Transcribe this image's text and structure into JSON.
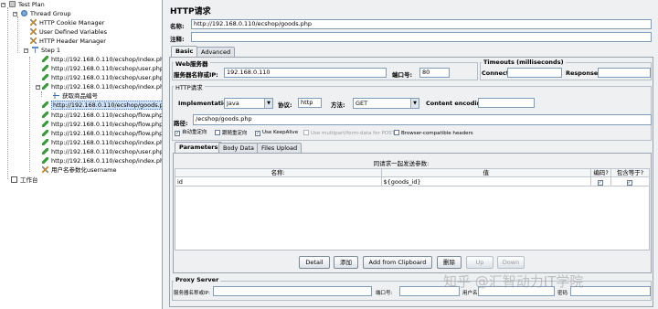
{
  "tree": {
    "items": [
      {
        "label": "Test Plan",
        "icon": "test-plan-icon"
      },
      {
        "label": "Thread Group",
        "icon": "thread-group-icon"
      },
      {
        "label": "HTTP Cookie Manager",
        "icon": "wrench-icon"
      },
      {
        "label": "User Defined Variables",
        "icon": "wrench-icon"
      },
      {
        "label": "HTTP Header Manager",
        "icon": "wrench-icon"
      },
      {
        "label": "Step 1",
        "icon": "step-icon"
      },
      {
        "label": "http://192.168.0.110/ecshop/index.php",
        "icon": "sampler-icon"
      },
      {
        "label": "http://192.168.0.110/ecshop/user.php",
        "icon": "sampler-icon"
      },
      {
        "label": "http://192.168.0.110/ecshop/user.php",
        "icon": "sampler-icon"
      },
      {
        "label": "http://192.168.0.110/ecshop/index.php",
        "icon": "sampler-icon"
      },
      {
        "label": "获取商品编号",
        "icon": "extractor-icon"
      },
      {
        "label": "http://192.168.0.110/ecshop/goods.php",
        "icon": "sampler-icon"
      },
      {
        "label": "http://192.168.0.110/ecshop/flow.php",
        "icon": "sampler-icon"
      },
      {
        "label": "http://192.168.0.110/ecshop/flow.php",
        "icon": "sampler-icon"
      },
      {
        "label": "http://192.168.0.110/ecshop/flow.php",
        "icon": "sampler-icon"
      },
      {
        "label": "http://192.168.0.110/ecshop/index.php",
        "icon": "sampler-icon"
      },
      {
        "label": "http://192.168.0.110/ecshop/user.php",
        "icon": "sampler-icon"
      },
      {
        "label": "http://192.168.0.110/ecshop/index.php",
        "icon": "sampler-icon"
      },
      {
        "label": "用户名参数化username",
        "icon": "wrench-icon"
      },
      {
        "label": "工作台",
        "icon": "workbench-icon"
      }
    ]
  },
  "panel": {
    "title": "HTTP请求",
    "name_label": "名称:",
    "name_value": "http://192.168.0.110/ecshop/goods.php",
    "comment_label": "注释:",
    "comment_value": "",
    "tabs": [
      "Basic",
      "Advanced"
    ]
  },
  "web_server": {
    "group_title": "Web服务器",
    "server_label": "服务器名称或IP:",
    "server_value": "192.168.0.110",
    "port_label": "端口号:",
    "port_value": "80"
  },
  "timeouts": {
    "group_title": "Timeouts (milliseconds)",
    "connect_label": "Connect:",
    "connect_value": "",
    "response_label": "Response:",
    "response_value": ""
  },
  "http_request": {
    "group_title": "HTTP请求",
    "impl_label": "Implementation:",
    "impl_value": "Java",
    "protocol_label": "协议:",
    "protocol_value": "http",
    "method_label": "方法:",
    "method_value": "GET",
    "encoding_label": "Content encoding:",
    "encoding_value": "",
    "path_label": "路径:",
    "path_value": "/ecshop/goods.php"
  },
  "options": [
    {
      "label": "自动重定向",
      "checked": true,
      "enabled": true
    },
    {
      "label": "跟随重定向",
      "checked": false,
      "enabled": true
    },
    {
      "label": "Use KeepAlive",
      "checked": true,
      "enabled": true
    },
    {
      "label": "Use multipart/form-data for POST",
      "checked": false,
      "enabled": false
    },
    {
      "label": "Browser-compatible headers",
      "checked": false,
      "enabled": true
    }
  ],
  "subtabs": [
    "Parameters",
    "Body Data",
    "Files Upload"
  ],
  "params": {
    "caption": "同请求一起发送参数:",
    "headers": [
      "名称:",
      "值",
      "编码?",
      "包含等于?"
    ],
    "rows": [
      {
        "name": "id",
        "value": "${goods_id}",
        "encode": true,
        "include_equals": true
      }
    ]
  },
  "buttons": [
    {
      "label": "Detail",
      "enabled": true
    },
    {
      "label": "添加",
      "enabled": true
    },
    {
      "label": "Add from Clipboard",
      "enabled": true
    },
    {
      "label": "删除",
      "enabled": true
    },
    {
      "label": "Up",
      "enabled": false
    },
    {
      "label": "Down",
      "enabled": false
    }
  ],
  "proxy": {
    "group_title": "Proxy Server",
    "server_label": "服务器名称或IP:",
    "port_label": "端口号:",
    "user_label": "用户名",
    "password_label": "密码"
  },
  "watermark": "知乎 @汇智动力IT学院"
}
